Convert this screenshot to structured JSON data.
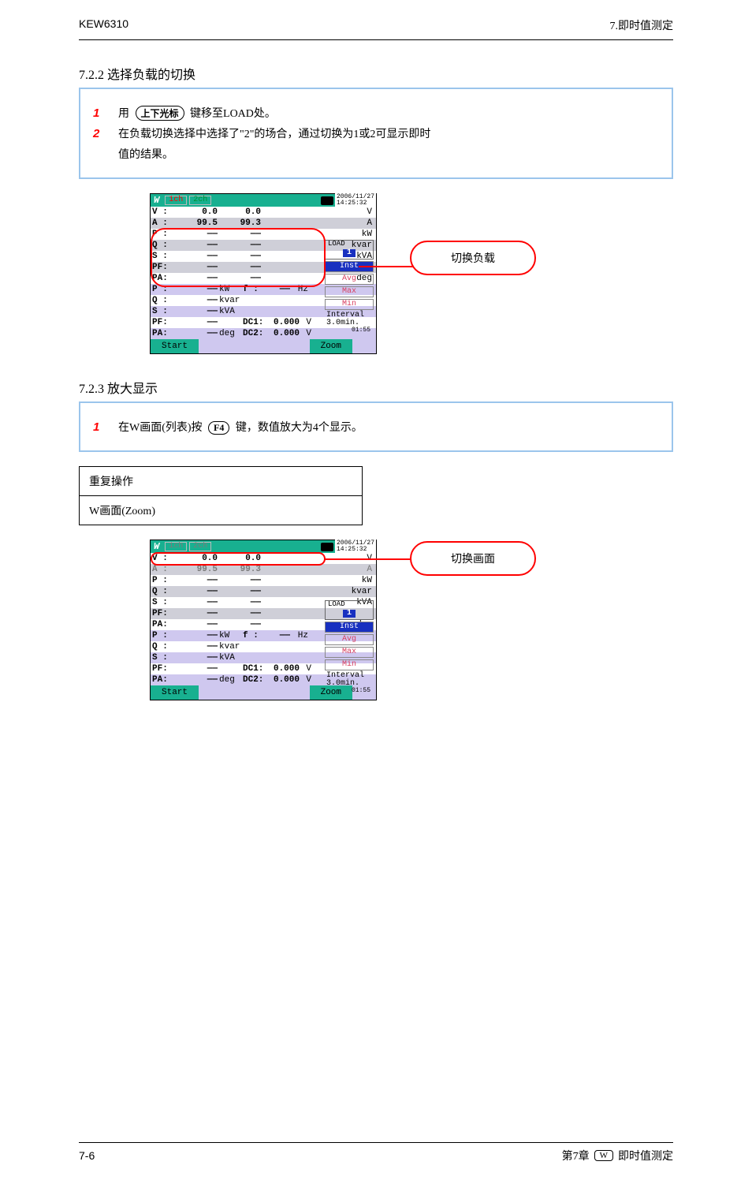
{
  "header": {
    "left": "KEW6310",
    "right": "7.即时值测定"
  },
  "section1_title": "7.2.2 选择负载的切换",
  "box1": {
    "step1_num": "1",
    "step1_text_a": "用",
    "step1_key": "上下光标",
    "step1_text_b": "键移至LOAD处。",
    "step2_num": "2",
    "step2_text_a": "在负载切换选择中选择了\"2\"的场合，通过切换为1或2可显示即时",
    "step2_text_b": "值的结果。"
  },
  "callout1": "切换负载",
  "section2_title": "7.2.3 放大显示",
  "box2": {
    "step1_num": "1",
    "step1_text_a": "在W画面(列表)按",
    "step1_key": "F4",
    "step1_text_b": "键，数值放大为4个显示。"
  },
  "opbox": {
    "header": "重复操作",
    "body": "W画面(Zoom)"
  },
  "callout2": "切换画面",
  "shot": {
    "w_logo": "W",
    "ch1": "1ch",
    "ch2": "2ch",
    "datetime1": "2006/11/27",
    "datetime2": "14:25:32",
    "rows": {
      "V": {
        "label": "V :",
        "v1": "0.0",
        "v2": "0.0",
        "unit": "V"
      },
      "A": {
        "label": "A :",
        "v1": "99.5",
        "v2": "99.3",
        "unit": "A"
      },
      "P": {
        "label": "P :",
        "v1": "——",
        "v2": "——",
        "unit": "kW"
      },
      "Q": {
        "label": "Q :",
        "v1": "——",
        "v2": "——",
        "unit": "kvar"
      },
      "S": {
        "label": "S :",
        "v1": "——",
        "v2": "——",
        "unit": "kVA"
      },
      "PF": {
        "label": "PF:",
        "v1": "——",
        "v2": "——",
        "unit": ""
      },
      "PA": {
        "label": "PA:",
        "v1": "——",
        "v2": "——",
        "unit": "deg"
      },
      "Pt": {
        "label": "P :",
        "v1": "——",
        "u1": "kW",
        "f": "f :",
        "fv": "——",
        "funit": "Hz"
      },
      "Qt": {
        "label": "Q :",
        "v1": "——",
        "u1": "kvar"
      },
      "St": {
        "label": "S :",
        "v1": "——",
        "u1": "kVA"
      },
      "PFt": {
        "label": "PF:",
        "v1": "——",
        "dc1l": "DC1:",
        "dc1v": "0.000",
        "dc1u": "V"
      },
      "PAt": {
        "label": "PA:",
        "v1": "——",
        "u1": "deg",
        "dc2l": "DC2:",
        "dc2v": "0.000",
        "dc2u": "V"
      }
    },
    "right": {
      "load": "LOAD",
      "load_num": "1",
      "inst": "Inst",
      "avg": "Avg",
      "max": "Max",
      "min": "Min",
      "interval": "Interval",
      "interval_v": "3.0min.",
      "interval_t": "01:55"
    },
    "bottom": {
      "start": "Start",
      "zoom": "Zoom"
    }
  },
  "footer": {
    "page": "7-6",
    "sec_left": "第7章",
    "sec_key": "W",
    "sec_right": "即时值测定"
  }
}
